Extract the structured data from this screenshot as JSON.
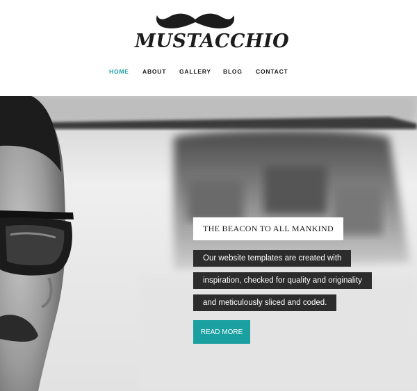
{
  "brand": {
    "name": "MUSTACCHIO"
  },
  "nav": {
    "items": [
      {
        "label": "HOME",
        "active": true
      },
      {
        "label": "ABOUT",
        "active": false
      },
      {
        "label": "GALLERY",
        "active": false
      },
      {
        "label": "BLOG",
        "active": false
      },
      {
        "label": "CONTACT",
        "active": false
      }
    ]
  },
  "hero": {
    "headline": "THE BEACON TO ALL MANKIND",
    "description_lines": [
      "Our website templates are created with",
      "inspiration, checked for quality and originality",
      "and meticulously sliced and coded."
    ],
    "cta_label": "READ MORE"
  },
  "colors": {
    "accent": "#1aa0a0",
    "text_dark": "#1a1a1a",
    "caption_bg": "#2c2c2c"
  }
}
